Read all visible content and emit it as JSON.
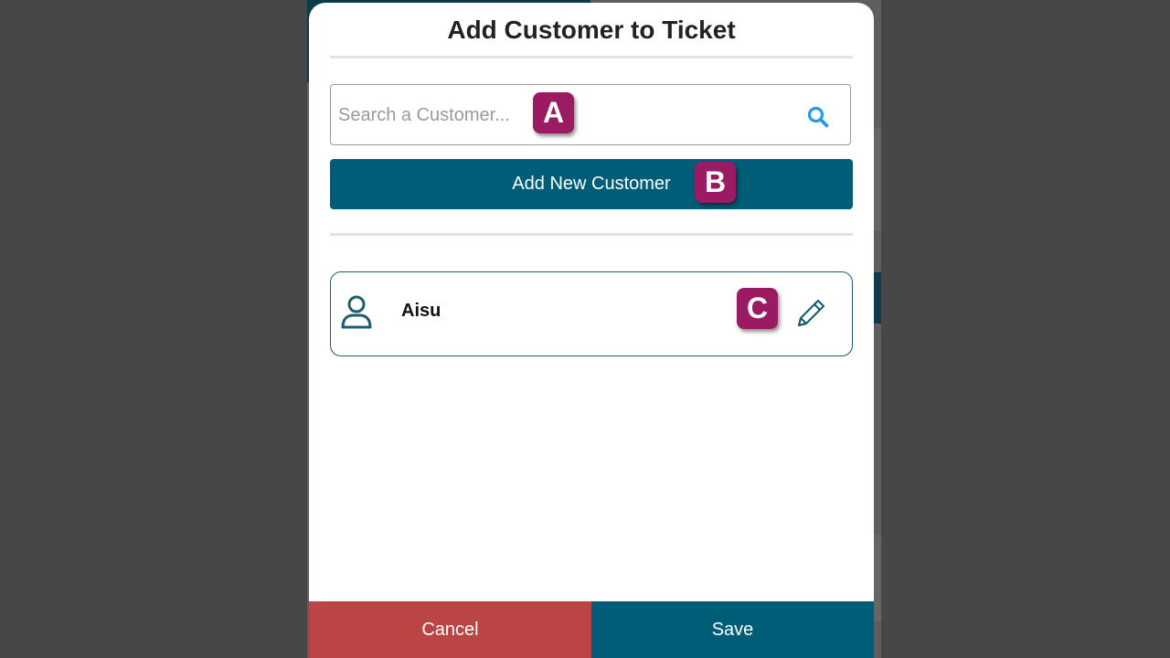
{
  "modal": {
    "title": "Add Customer to Ticket"
  },
  "search": {
    "placeholder": "Search a Customer...",
    "value": "",
    "icon": "search-icon"
  },
  "add_customer_label": "Add New Customer",
  "customers": [
    {
      "name": "Aisu",
      "icon": "user-icon",
      "edit_icon": "pencil-icon"
    }
  ],
  "footer": {
    "cancel_label": "Cancel",
    "save_label": "Save"
  },
  "annotations": {
    "a": "A",
    "b": "B",
    "c": "C"
  },
  "colors": {
    "primary": "#005d78",
    "cancel": "#bb4444",
    "badge": "#9b1b63",
    "overlay": "#474747"
  }
}
